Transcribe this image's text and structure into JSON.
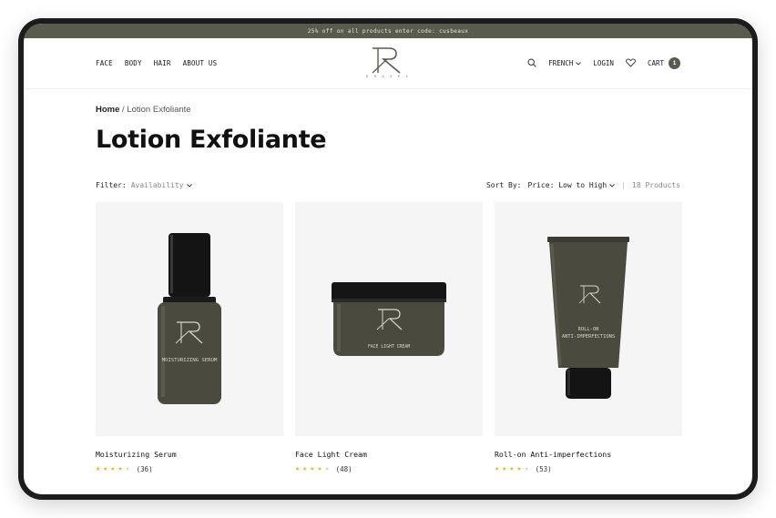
{
  "promo": {
    "text": "25% off on all products enter code: cusbeaux"
  },
  "nav": {
    "left_items": [
      "FACE",
      "BODY",
      "HAIR",
      "ABOUT US"
    ],
    "logo_sub": "R H A Z E S",
    "language": "FRENCH",
    "login": "LOGIN",
    "cart_label": "CART",
    "cart_count": "1"
  },
  "breadcrumb": {
    "home": "Home",
    "separator": " / ",
    "current": "Lotion Exfoliante"
  },
  "page": {
    "title": "Lotion Exfoliante"
  },
  "toolbar": {
    "filter_label": "Filter:",
    "filter_value": "Availability",
    "sort_label": "Sort By:",
    "sort_value": "Price: Low to High",
    "divider": "|",
    "count": "18 Products"
  },
  "products": [
    {
      "name": "Moisturizing Serum",
      "rating": 4,
      "reviews": "(36)",
      "label": "MOISTURIZING SERUM"
    },
    {
      "name": "Face Light Cream",
      "rating": 4,
      "reviews": "(48)",
      "label": "FACE LIGHT CREAM"
    },
    {
      "name": "Roll-on Anti-imperfections",
      "rating": 4,
      "reviews": "(53)",
      "label_line1": "ROLL-ON",
      "label_line2": "ANTI-IMPERFECTIONS"
    }
  ],
  "colors": {
    "accent": "#5b5a4e",
    "product": "#4a4a3f",
    "star": "#e6b422"
  }
}
